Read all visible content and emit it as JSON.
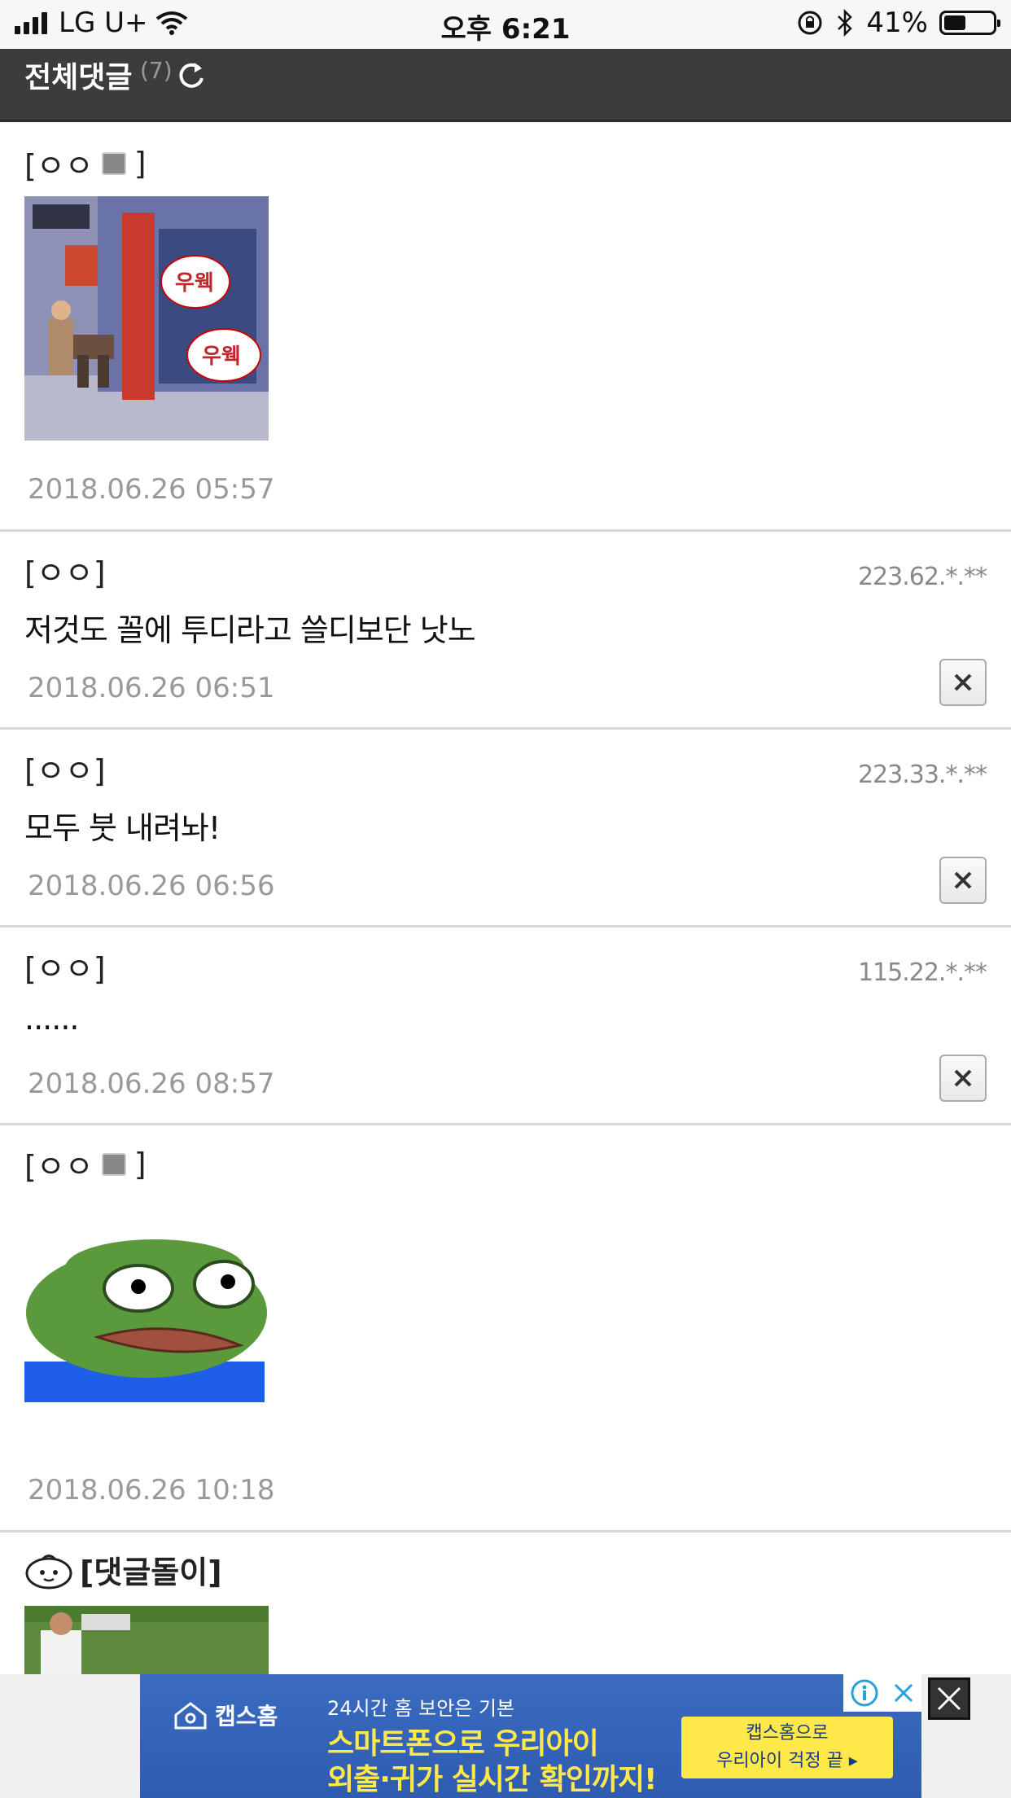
{
  "status_bar": {
    "carrier": "LG U+",
    "time": "오후 6:21",
    "battery": "41%"
  },
  "header": {
    "title": "전체댓글",
    "count": "(7)"
  },
  "comments": [
    {
      "author": "[ㅇㅇ",
      "author_suffix": "]",
      "has_badge": true,
      "ip": "",
      "text": "",
      "date": "2018.06.26 05:57",
      "image": "comic-image"
    },
    {
      "author": "[ㅇㅇ]",
      "ip": "223.62.*.**",
      "text": "저것도 꼴에 투디라고 쓸디보단 낫노",
      "date": "2018.06.26 06:51"
    },
    {
      "author": "[ㅇㅇ]",
      "ip": "223.33.*.**",
      "text": "모두 붓 내려놔!",
      "date": "2018.06.26 06:56"
    },
    {
      "author": "[ㅇㅇ]",
      "ip": "115.22.*.**",
      "text": "......",
      "date": "2018.06.26 08:57"
    },
    {
      "author": "[ㅇㅇ",
      "author_suffix": "]",
      "has_badge": true,
      "ip": "",
      "text": "",
      "date": "2018.06.26 10:18",
      "image": "frog-image"
    },
    {
      "author": "[댓글돌이]",
      "image": "soccer-image"
    }
  ],
  "ad": {
    "brand": "캡스홈",
    "line1": "24시간 홈 보안은 기본",
    "line2": "스마트폰으로 우리아이",
    "line3": "외출·귀가 실시간 확인까지!",
    "cta_line1": "캡스홈으로",
    "cta_line2": "우리아이 걱정 끝 ▸"
  },
  "colors": {
    "header_bg": "#3c3c3c",
    "ad_bg": "#3a6cc0",
    "ad_accent": "#ffe84a"
  }
}
